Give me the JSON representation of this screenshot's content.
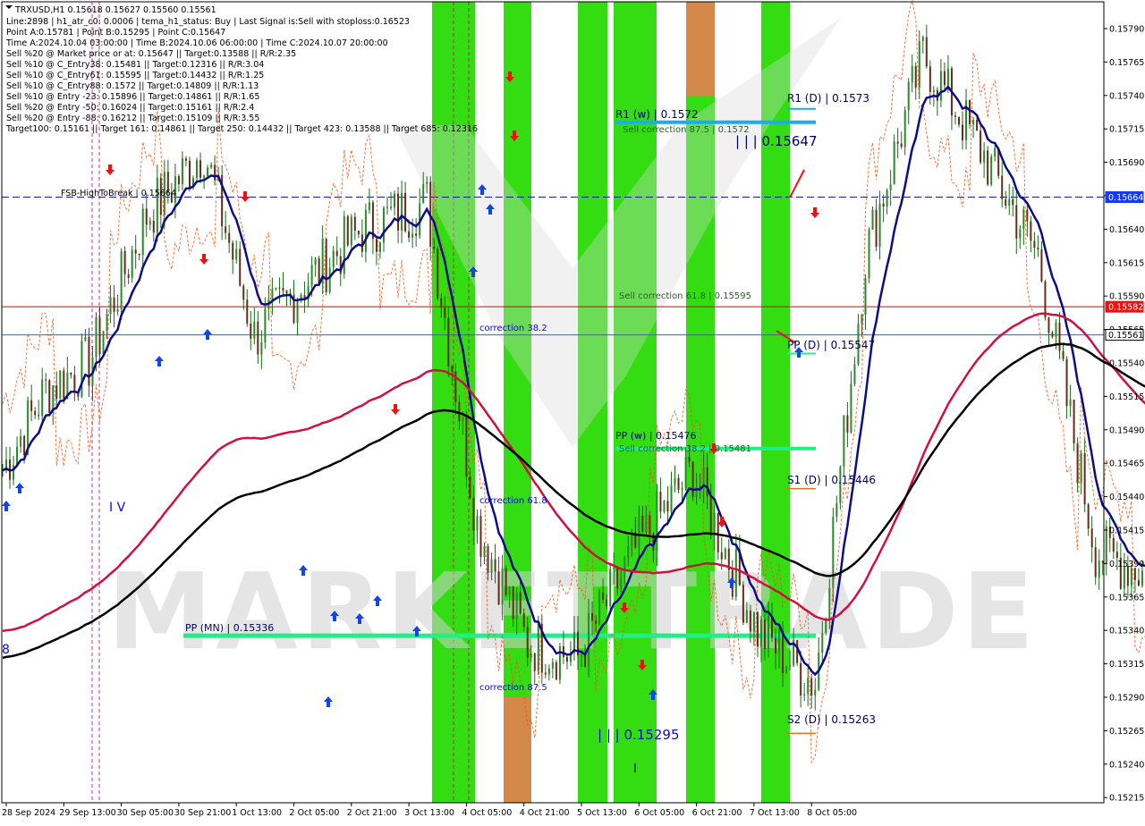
{
  "window": {
    "symbol_line": "TRXUSD,H1  0.15618 0.15627 0.15560 0.15561"
  },
  "info_lines": [
    "Line:2898 | h1_atr_c0: 0.0006 | tema_h1_status: Buy | Last Signal is:Sell with stoploss:0.16523",
    "Point A:0.15781 | Point B:0.15295 | Point C:0.15647",
    "Time A:2024.10.04 03:00:00 | Time B:2024.10.06 06:00:00 | Time C:2024.10.07 20:00:00",
    "Sell %20 @ Market price or at: 0.15647 || Target:0.13588 || R/R:2.35",
    "Sell %10 @ C_Entry38: 0.15481 || Target:0.12316 || R/R:3.04",
    "Sell %10 @ C_Entry61: 0.15595 || Target:0.14432 || R/R:1.25",
    "Sell %10 @ C_Entry88: 0.1572 || Target:0.14809 || R/R:1.13",
    "Sell %10 @ Entry -23: 0.15896 || Target:0.14861 || R/R:1.65",
    "Sell %20 @ Entry -50: 0.16024 || Target:0.15161 || R/R:2.4",
    "Sell %20 @ Entry -88: 0.16212 || Target:0.15109 || R/R:3.55",
    "Target100: 0.15161 || Target 161: 0.14861 || Target 250: 0.14432 || Target 423: 0.13588 || Target 685: 0.12316"
  ],
  "watermark": "MARKETTRADE",
  "colors": {
    "green_zone": "#33dd11",
    "orange_zone": "#d4894a",
    "tema_line": "#0c0c88",
    "ema_red": "#d01040",
    "ema_black": "#000000",
    "pivot_green": "#22ee88",
    "r1_weekly": "#1eaaee",
    "dashed_blue": "#1a1aaa",
    "price_red": "#dd0000",
    "candle": "#1a6a1a"
  },
  "chart_data": {
    "type": "candlestick",
    "symbol": "TRXUSD",
    "timeframe": "H1",
    "ohlc_current": {
      "open": 0.15618,
      "high": 0.15627,
      "low": 0.1556,
      "close": 0.15561
    },
    "price_axis": {
      "ticks": [
        "0.15790",
        "0.15765",
        "0.15740",
        "0.15715",
        "0.15690",
        "0.15665",
        "0.15640",
        "0.15615",
        "0.15590",
        "0.15565",
        "0.15540",
        "0.15515",
        "0.15490",
        "0.15465",
        "0.15440",
        "0.15415",
        "0.15390",
        "0.15365",
        "0.15340",
        "0.15315",
        "0.15290",
        "0.15265",
        "0.15240",
        "0.15215"
      ],
      "ylim": [
        0.152,
        0.158
      ]
    },
    "time_axis": {
      "labels": [
        "28 Sep 2024",
        "29 Sep 13:00",
        "30 Sep 05:00",
        "30 Sep 21:00",
        "1 Oct 13:00",
        "2 Oct 05:00",
        "2 Oct 21:00",
        "3 Oct 13:00",
        "4 Oct 05:00",
        "4 Oct 21:00",
        "5 Oct 13:00",
        "6 Oct 05:00",
        "6 Oct 21:00",
        "7 Oct 13:00",
        "8 Oct 05:00"
      ]
    },
    "price_tags": [
      {
        "value": "0.15664",
        "kind": "dashed-level"
      },
      {
        "value": "0.15582",
        "kind": "red-level"
      },
      {
        "value": "0.15561",
        "kind": "current"
      }
    ],
    "levels": [
      {
        "label": "R1 (D) | 0.1573",
        "price": 0.1573
      },
      {
        "label": "R1 (w) | 0.1572",
        "price": 0.1572
      },
      {
        "label": "Sell correction 87.5 | 0.1572",
        "price": 0.1572
      },
      {
        "label": "| | | 0.15647",
        "price": 0.15647
      },
      {
        "label": "FSB-HighToBreak | 0.15664",
        "price": 0.15664
      },
      {
        "label": "Sell correction 61.8 | 0.15595",
        "price": 0.15595
      },
      {
        "label": "correction 38.2",
        "price": 0.15561
      },
      {
        "label": "PP (D) | 0.15547",
        "price": 0.15547
      },
      {
        "label": "PP (w) | 0.15476",
        "price": 0.15476
      },
      {
        "label": "Sell correction 38.2 | 0.15481",
        "price": 0.15476
      },
      {
        "label": "S1 (D) | 0.15446",
        "price": 0.15446
      },
      {
        "label": "correction 61.8",
        "price": 0.15431
      },
      {
        "label": "PP (MN) | 0.15336",
        "price": 0.15336
      },
      {
        "label": "correction 87.5",
        "price": 0.15301
      },
      {
        "label": "| | | 0.15295",
        "price": 0.15295
      },
      {
        "label": "S2 (D) | 0.15263",
        "price": 0.15263
      }
    ],
    "wave_labels": [
      "I V",
      "8",
      "I"
    ]
  }
}
